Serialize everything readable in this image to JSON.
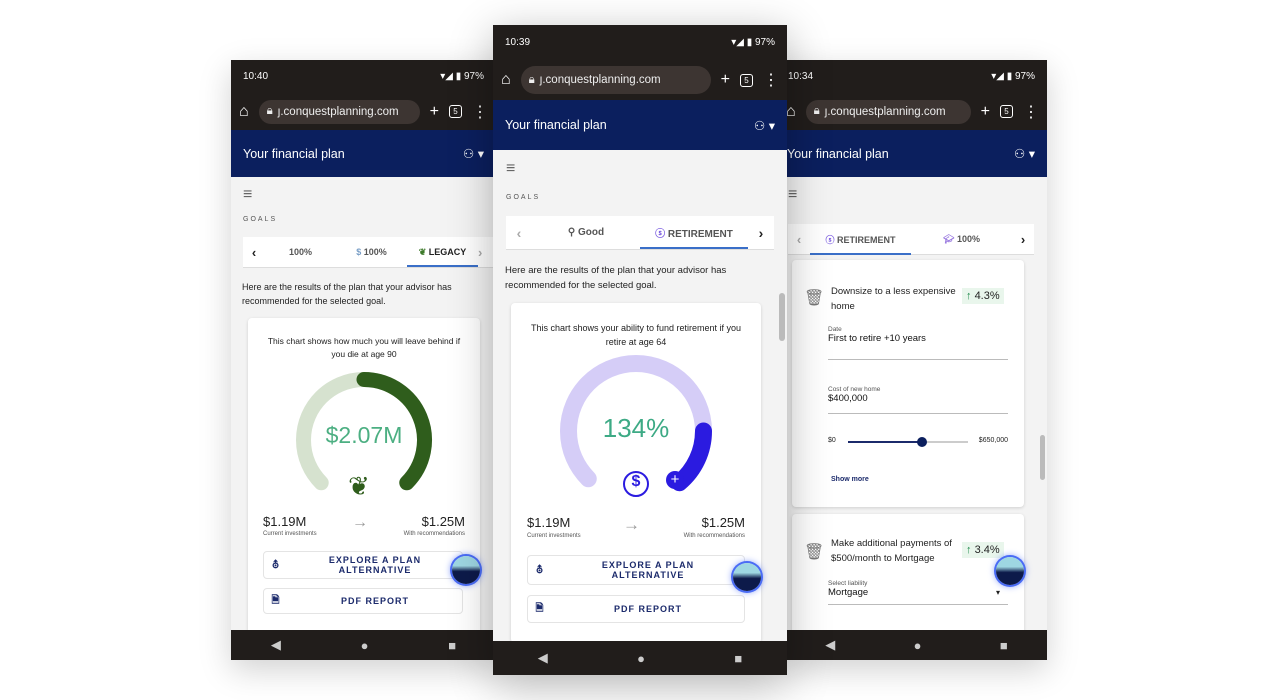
{
  "common": {
    "url": "ȷ.conquestplanning.com",
    "tabs_count": "5",
    "battery": "97%",
    "header_title": "Your financial plan",
    "goals_label": "GOALS",
    "intro": "Here are the results of the plan that your advisor has recommended for the selected goal.",
    "current_amount": "$1.19M",
    "current_label": "Current investments",
    "rec_amount": "$1.25M",
    "rec_label": "With recommendations",
    "explore_label": "EXPLORE A PLAN ALTERNATIVE",
    "pdf_label": "PDF REPORT"
  },
  "left": {
    "time": "10:40",
    "tabs": [
      "100%",
      "100%",
      "LEGACY"
    ],
    "chart_title": "This chart shows how much you will leave behind if you die at age 90",
    "gauge_value": "$2.07M",
    "gauge_fill": 0.5,
    "colors": {
      "track": "#d6e2cf",
      "fill": "#2f5d1c",
      "text": "#4caf82"
    }
  },
  "center": {
    "time": "10:39",
    "tabs": [
      "Good",
      "RETIREMENT"
    ],
    "chart_title": "This chart shows your ability to fund retirement if you retire at age 64",
    "gauge_value": "134%",
    "colors": {
      "track": "#d5cdf7",
      "fill": "#2b1be0",
      "text": "#3daa85"
    }
  },
  "right": {
    "time": "10:34",
    "tabs": [
      "RETIREMENT",
      "100%"
    ],
    "rec1": {
      "title": "Downsize to a less expensive home",
      "change": "4.3%",
      "date_label": "Date",
      "date_value": "First to retire +10 years",
      "cost_label": "Cost of new home",
      "cost_value": "$400,000",
      "slider_min": "$0",
      "slider_max": "$650,000",
      "slider_value": 400000,
      "show_more": "Show more"
    },
    "rec2": {
      "title": "Make additional payments of $500/month to Mortgage",
      "change": "3.4%",
      "select_label": "Select liability",
      "select_value": "Mortgage"
    }
  }
}
